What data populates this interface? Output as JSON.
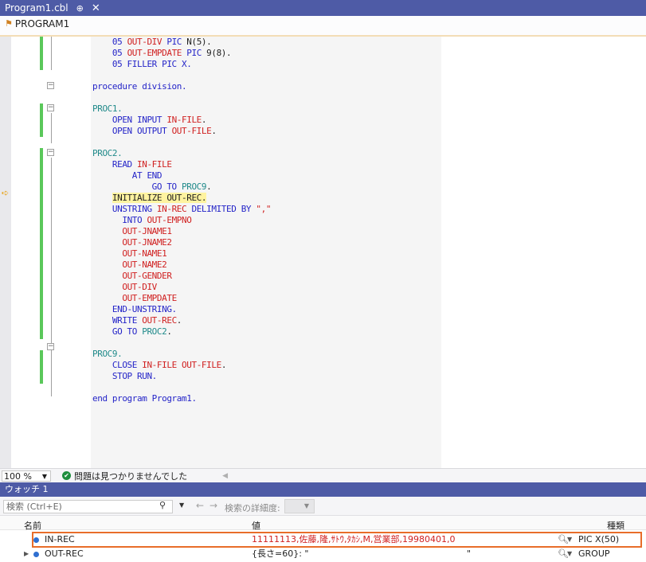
{
  "tab": {
    "title": "Program1.cbl",
    "pin_glyph": "⊕",
    "close_glyph": "✕"
  },
  "navbar": {
    "scope": "PROGRAM1"
  },
  "code": [
    {
      "indent": "    ",
      "parts": [
        [
          "05 ",
          "kw"
        ],
        [
          "OUT-DIV",
          "id"
        ],
        [
          " ",
          ""
        ],
        [
          "PIC",
          "kw"
        ],
        [
          " N(5).",
          ""
        ]
      ]
    },
    {
      "indent": "    ",
      "parts": [
        [
          "05 ",
          "kw"
        ],
        [
          "OUT-EMPDATE",
          "id"
        ],
        [
          " ",
          ""
        ],
        [
          "PIC",
          "kw"
        ],
        [
          " 9(8).",
          ""
        ]
      ]
    },
    {
      "indent": "    ",
      "parts": [
        [
          "05 FILLER PIC X.",
          "kw"
        ]
      ]
    },
    {
      "indent": "",
      "parts": []
    },
    {
      "indent": "",
      "parts": [
        [
          "procedure division.",
          "kw"
        ]
      ]
    },
    {
      "indent": "",
      "parts": []
    },
    {
      "indent": "",
      "parts": [
        [
          "PROC1.",
          "lbl"
        ]
      ]
    },
    {
      "indent": "    ",
      "parts": [
        [
          "OPEN INPUT ",
          "kw"
        ],
        [
          "IN-FILE",
          "id"
        ],
        [
          ".",
          ""
        ]
      ]
    },
    {
      "indent": "    ",
      "parts": [
        [
          "OPEN OUTPUT ",
          "kw"
        ],
        [
          "OUT-FILE",
          "id"
        ],
        [
          ".",
          ""
        ]
      ]
    },
    {
      "indent": "",
      "parts": []
    },
    {
      "indent": "",
      "parts": [
        [
          "PROC2.",
          "lbl"
        ]
      ]
    },
    {
      "indent": "    ",
      "parts": [
        [
          "READ ",
          "kw"
        ],
        [
          "IN-FILE",
          "id"
        ]
      ]
    },
    {
      "indent": "        ",
      "parts": [
        [
          "AT END",
          "kw"
        ]
      ]
    },
    {
      "indent": "            ",
      "parts": [
        [
          "GO TO ",
          "kw"
        ],
        [
          "PROC9",
          "lbl"
        ],
        [
          ".",
          ""
        ]
      ]
    },
    {
      "indent": "    ",
      "parts": [
        [
          "INITIALIZE OUT-REC.",
          "hl"
        ]
      ]
    },
    {
      "indent": "    ",
      "parts": [
        [
          "UNSTRING ",
          "kw"
        ],
        [
          "IN-REC",
          "id"
        ],
        [
          " DELIMITED BY ",
          "kw"
        ],
        [
          "\",\"",
          "id"
        ]
      ]
    },
    {
      "indent": "      ",
      "parts": [
        [
          "INTO ",
          "kw"
        ],
        [
          "OUT-EMPNO",
          "id"
        ]
      ]
    },
    {
      "indent": "      ",
      "parts": [
        [
          "OUT-JNAME1",
          "id"
        ]
      ]
    },
    {
      "indent": "      ",
      "parts": [
        [
          "OUT-JNAME2",
          "id"
        ]
      ]
    },
    {
      "indent": "      ",
      "parts": [
        [
          "OUT-NAME1",
          "id"
        ]
      ]
    },
    {
      "indent": "      ",
      "parts": [
        [
          "OUT-NAME2",
          "id"
        ]
      ]
    },
    {
      "indent": "      ",
      "parts": [
        [
          "OUT-GENDER",
          "id"
        ]
      ]
    },
    {
      "indent": "      ",
      "parts": [
        [
          "OUT-DIV",
          "id"
        ]
      ]
    },
    {
      "indent": "      ",
      "parts": [
        [
          "OUT-EMPDATE",
          "id"
        ]
      ]
    },
    {
      "indent": "    ",
      "parts": [
        [
          "END-UNSTRING.",
          "kw"
        ]
      ]
    },
    {
      "indent": "    ",
      "parts": [
        [
          "WRITE ",
          "kw"
        ],
        [
          "OUT-REC",
          "id"
        ],
        [
          ".",
          ""
        ]
      ]
    },
    {
      "indent": "    ",
      "parts": [
        [
          "GO TO ",
          "kw"
        ],
        [
          "PROC2",
          "lbl"
        ],
        [
          ".",
          ""
        ]
      ]
    },
    {
      "indent": "",
      "parts": []
    },
    {
      "indent": "",
      "parts": [
        [
          "PROC9.",
          "lbl"
        ]
      ]
    },
    {
      "indent": "    ",
      "parts": [
        [
          "CLOSE ",
          "kw"
        ],
        [
          "IN-FILE",
          "id"
        ],
        [
          " ",
          ""
        ],
        [
          "OUT-FILE",
          "id"
        ],
        [
          ".",
          ""
        ]
      ]
    },
    {
      "indent": "    ",
      "parts": [
        [
          "STOP RUN.",
          "kw"
        ]
      ]
    },
    {
      "indent": "",
      "parts": []
    },
    {
      "indent": "",
      "parts": [
        [
          "end program Program1.",
          "kw"
        ]
      ]
    }
  ],
  "status": {
    "zoom": "100 %",
    "message": "問題は見つかりませんでした"
  },
  "watch": {
    "title": "ウォッチ 1",
    "search_placeholder": "検索 (Ctrl+E)",
    "depth_label": "検索の詳細度:",
    "columns": {
      "name": "名前",
      "value": "値",
      "type": "種類"
    },
    "rows": [
      {
        "name": "IN-REC",
        "value": "11111113,佐藤,隆,ｻﾄｳ,ﾀｶｼ,M,営業部,19980401,0",
        "type": "PIC X(50)",
        "changed": true,
        "expandable": false
      },
      {
        "name": "OUT-REC",
        "value": "{長さ=60}: \"",
        "value_tail": "\"",
        "type": "GROUP",
        "changed": false,
        "expandable": true
      }
    ]
  },
  "colors": {
    "accent": "#4e5ba6",
    "highlight_border": "#e86d2a",
    "keyword": "#2424c8",
    "identifier": "#d02020",
    "label": "#208a8a"
  }
}
